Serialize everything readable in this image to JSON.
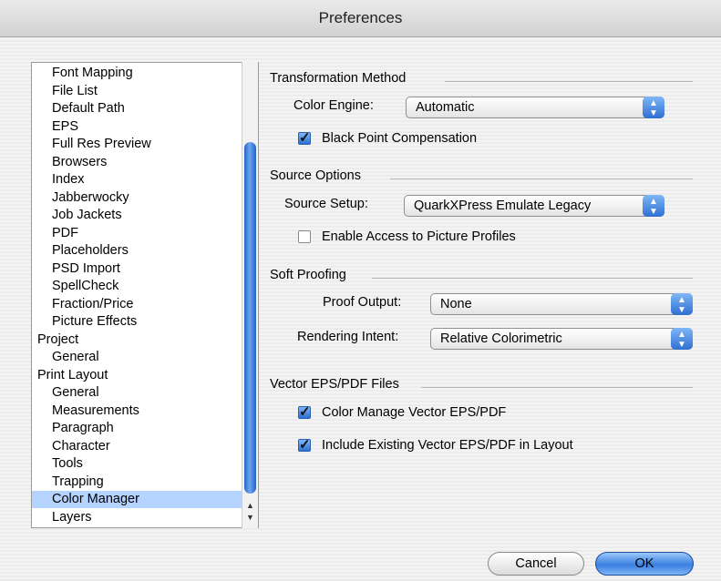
{
  "window": {
    "title": "Preferences"
  },
  "sidebar": {
    "items": [
      {
        "label": "Font Mapping",
        "level": 1
      },
      {
        "label": "File List",
        "level": 1
      },
      {
        "label": "Default Path",
        "level": 1
      },
      {
        "label": "EPS",
        "level": 1
      },
      {
        "label": "Full Res Preview",
        "level": 1
      },
      {
        "label": "Browsers",
        "level": 1
      },
      {
        "label": "Index",
        "level": 1
      },
      {
        "label": "Jabberwocky",
        "level": 1
      },
      {
        "label": "Job Jackets",
        "level": 1
      },
      {
        "label": "PDF",
        "level": 1
      },
      {
        "label": "Placeholders",
        "level": 1
      },
      {
        "label": "PSD Import",
        "level": 1
      },
      {
        "label": "SpellCheck",
        "level": 1
      },
      {
        "label": "Fraction/Price",
        "level": 1
      },
      {
        "label": "Picture Effects",
        "level": 1
      },
      {
        "label": "Project",
        "level": 0
      },
      {
        "label": "General",
        "level": 1
      },
      {
        "label": "Print Layout",
        "level": 0
      },
      {
        "label": "General",
        "level": 1
      },
      {
        "label": "Measurements",
        "level": 1
      },
      {
        "label": "Paragraph",
        "level": 1
      },
      {
        "label": "Character",
        "level": 1
      },
      {
        "label": "Tools",
        "level": 1
      },
      {
        "label": "Trapping",
        "level": 1
      },
      {
        "label": "Color Manager",
        "level": 1,
        "selected": true
      },
      {
        "label": "Layers",
        "level": 1
      }
    ]
  },
  "transformation": {
    "title": "Transformation Method",
    "color_engine_label": "Color Engine:",
    "color_engine_value": "Automatic",
    "black_point_label": "Black Point Compensation",
    "black_point_checked": true
  },
  "source": {
    "title": "Source Options",
    "setup_label": "Source Setup:",
    "setup_value": "QuarkXPress Emulate Legacy",
    "enable_access_label": "Enable Access to Picture Profiles",
    "enable_access_checked": false
  },
  "soft_proofing": {
    "title": "Soft Proofing",
    "proof_output_label": "Proof Output:",
    "proof_output_value": "None",
    "rendering_intent_label": "Rendering Intent:",
    "rendering_intent_value": "Relative Colorimetric"
  },
  "vector": {
    "title": "Vector EPS/PDF Files",
    "manage_label": "Color Manage Vector EPS/PDF",
    "manage_checked": true,
    "include_label": "Include Existing Vector EPS/PDF in Layout",
    "include_checked": true
  },
  "buttons": {
    "cancel": "Cancel",
    "ok": "OK"
  },
  "colors": {
    "selection": "#b5d3ff",
    "accent": "#3a7fe0"
  }
}
